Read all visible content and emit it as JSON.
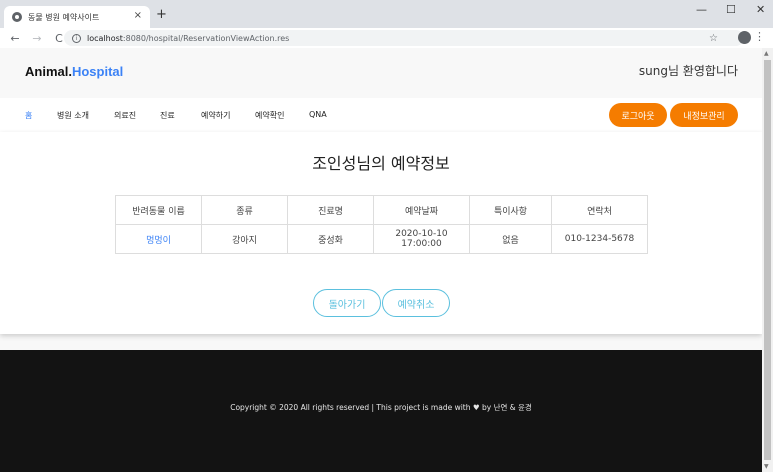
{
  "browser": {
    "tab_title": "동물 병원 예약사이트",
    "tab_close": "×",
    "new_tab": "+",
    "window_minimize": "—",
    "window_maximize": "☐",
    "window_close": "✕",
    "back": "←",
    "forward": "→",
    "reload": "C",
    "url_host": "localhost",
    "url_path": ":8080/hospital/ReservationViewAction.res",
    "star": "☆",
    "menu": "⋮"
  },
  "header": {
    "brand_animal": "Animal",
    "brand_dot": ".",
    "brand_hospital": "Hospital",
    "welcome": "sung님 환영합니다"
  },
  "nav": {
    "items": [
      "홈",
      "병원 소개",
      "의료진",
      "진료",
      "예약하기",
      "예약확인",
      "QNA"
    ],
    "logout": "로그아웃",
    "mypage": "내정보관리"
  },
  "main": {
    "title": "조인성님의 예약정보",
    "table": {
      "headers": [
        "반려동물 이름",
        "종류",
        "진료명",
        "예약날짜",
        "특이사항",
        "연락처"
      ],
      "row": [
        "멍멍이",
        "강아지",
        "중성화",
        "2020-10-10 17:00:00",
        "없음",
        "010-1234-5678"
      ]
    },
    "back_button": "돌아가기",
    "cancel_button": "예약취소"
  },
  "footer": {
    "copyright": "Copyright © 2020 All rights reserved | This project is made with ♥ by 난연 & 윤경"
  },
  "colors": {
    "brand_blue": "#3b82f6",
    "orange": "#f57c00",
    "outline_teal": "#5bc0de",
    "footer_bg": "#131313"
  }
}
